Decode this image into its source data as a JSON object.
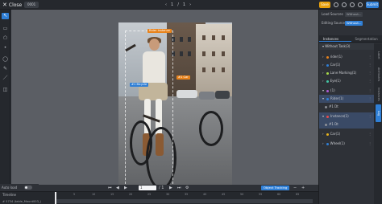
{
  "topbar": {
    "close_label": "Close",
    "frame_chip": "0001",
    "page_current": "1",
    "page_sep": "/",
    "page_total": "1",
    "save_label": "Save",
    "submit_label": "Submit"
  },
  "right_panel": {
    "load_sources_label": "Load Sources",
    "load_sources_value": "Without...",
    "editing_source_label": "Editing Source",
    "editing_source_value": "Without...",
    "tabs": [
      {
        "label": "Instances"
      },
      {
        "label": "Segmentation"
      }
    ],
    "task_label": "Without Task(3)",
    "labels": [
      {
        "name": "rider(1)",
        "color": "#e8831c"
      },
      {
        "name": "Car(1)",
        "color": "#2f7fd6"
      },
      {
        "name": "Lane Marking(1)",
        "color": "#a6d94a"
      },
      {
        "name": "Eye(1)",
        "color": "#43c6a6"
      },
      {
        "name": "(1)",
        "color": "#b05bd6"
      },
      {
        "name": "Rider(1)",
        "color": "#2f7fd6"
      },
      {
        "name": "#1  Dt",
        "color": "#8d9097"
      },
      {
        "name": "Instance(1)",
        "color": "#e84a4a"
      },
      {
        "name": "#1  Dt",
        "color": "#8d9097"
      },
      {
        "name": "Car(1)",
        "color": "#e8b31c"
      },
      {
        "name": "Wheel(1)",
        "color": "#2f7fd6"
      }
    ],
    "vtabs": [
      "Label",
      "Attributes",
      "Instances",
      "Log"
    ]
  },
  "canvas": {
    "tags": {
      "top": "Rider  Instance",
      "left": "#1 Bicycle",
      "right": "#1 Car"
    }
  },
  "controls": {
    "autoload_label": "Auto load",
    "frame_value": "1",
    "frame_total": "/ 1",
    "object_tracking_label": "Object Tracking"
  },
  "timeline": {
    "label": "Timeline",
    "file_label": "# 5734 (table_Mount003_)",
    "ticks": [
      "0",
      "5",
      "10",
      "15",
      "20",
      "25",
      "30",
      "35",
      "40",
      "45",
      "50",
      "55",
      "60",
      "65"
    ]
  },
  "colors": {
    "accent": "#2f7fd6",
    "warning": "#e8a10d",
    "orange_tag": "#e8831c"
  }
}
